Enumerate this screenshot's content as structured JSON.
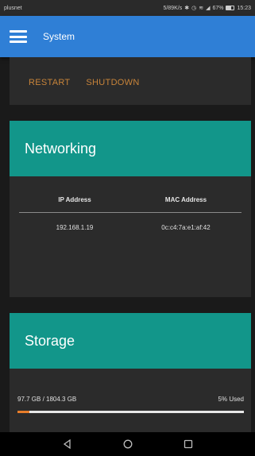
{
  "status_bar": {
    "carrier": "plusnet",
    "speed": "5/89K/s",
    "icons": [
      "bluetooth-icon",
      "alarm-icon",
      "wifi-icon",
      "signal-icon"
    ],
    "battery_percent": "67%",
    "battery_level": 0.67,
    "time": "15:23"
  },
  "app_bar": {
    "menu_icon": "hamburger-menu-icon",
    "title": "System"
  },
  "power": {
    "restart_label": "RESTART",
    "shutdown_label": "SHUTDOWN"
  },
  "networking": {
    "title": "Networking",
    "columns": [
      "IP Address",
      "MAC Address"
    ],
    "rows": [
      [
        "192.168.1.19",
        "0c:c4:7a:e1:af:42"
      ]
    ]
  },
  "storage": {
    "title": "Storage",
    "usage_text": "97.7 GB / 1804.3 GB",
    "used_label": "5% Used",
    "used_fraction": 0.054
  },
  "colors": {
    "app_bar": "#2f7fd6",
    "card_header": "#12968a",
    "card_bg": "#2b2b2b",
    "page_bg": "#1a1a1a",
    "action_text": "#c8843a",
    "progress_fill": "#e87d2a"
  },
  "nav_bar": {
    "buttons": [
      "back-icon",
      "home-icon",
      "recents-icon"
    ]
  }
}
